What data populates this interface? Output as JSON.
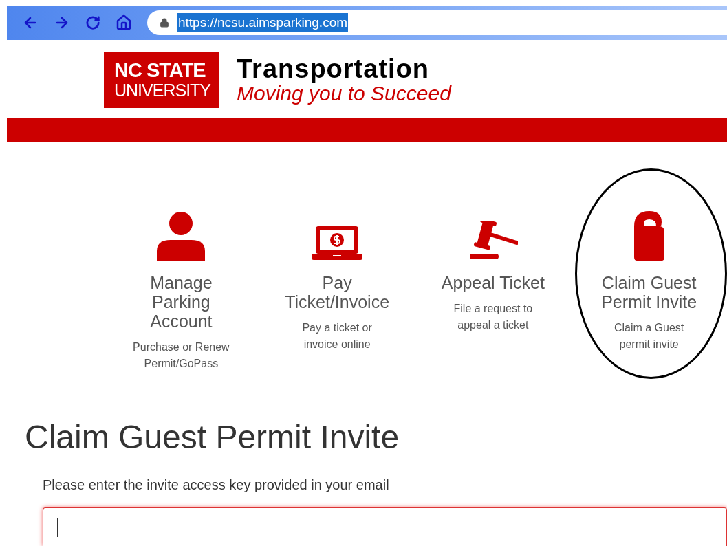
{
  "browser": {
    "url": "https://ncsu.aimsparking.com",
    "url_selected": true
  },
  "header": {
    "logo_line_1": "NC STATE",
    "logo_line_2": "UNIVERSITY",
    "title": "Transportation",
    "tagline": "Moving you to Succeed"
  },
  "services": [
    {
      "kind": "person",
      "title": "Manage Parking Account",
      "description": "Purchase or Renew Permit/GoPass",
      "circled": false
    },
    {
      "kind": "laptop",
      "title": "Pay Ticket/Invoice",
      "description": "Pay a ticket or invoice online",
      "circled": false
    },
    {
      "kind": "gavel",
      "title": "Appeal Ticket",
      "description": "File a request to appeal a ticket",
      "circled": false
    },
    {
      "kind": "hanger",
      "title": "Claim Guest Permit Invite",
      "description": "Claim a Guest permit invite",
      "circled": true
    }
  ],
  "claim_form": {
    "heading": "Claim Guest Permit Invite",
    "label": "Please enter the invite access key provided in your email",
    "focused": true
  }
}
